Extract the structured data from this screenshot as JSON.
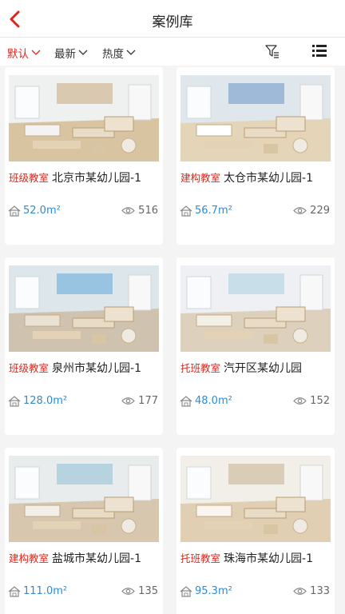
{
  "header": {
    "title": "案例库"
  },
  "filters": {
    "sorts": [
      {
        "label": "默认",
        "active": true
      },
      {
        "label": "最新",
        "active": false
      },
      {
        "label": "热度",
        "active": false
      }
    ],
    "filter_icon": "filter-icon",
    "list_icon": "list-view-icon"
  },
  "colors": {
    "accent": "#e1251b",
    "area": "#2e8bd6"
  },
  "cases": [
    {
      "tag": "班级教室",
      "name": "北京市某幼儿园-1",
      "area": "52.0m²",
      "views": "516"
    },
    {
      "tag": "建构教室",
      "name": "太仓市某幼儿园-1",
      "area": "56.7m²",
      "views": "229"
    },
    {
      "tag": "班级教室",
      "name": "泉州市某幼儿园-1",
      "area": "128.0m²",
      "views": "177"
    },
    {
      "tag": "托班教室",
      "name": "汽开区某幼儿园",
      "area": "48.0m²",
      "views": "152"
    },
    {
      "tag": "建构教室",
      "name": "盐城市某幼儿园-1",
      "area": "111.0m²",
      "views": "135"
    },
    {
      "tag": "托班教室",
      "name": "珠海市某幼儿园-1",
      "area": "95.3m²",
      "views": "133"
    }
  ]
}
